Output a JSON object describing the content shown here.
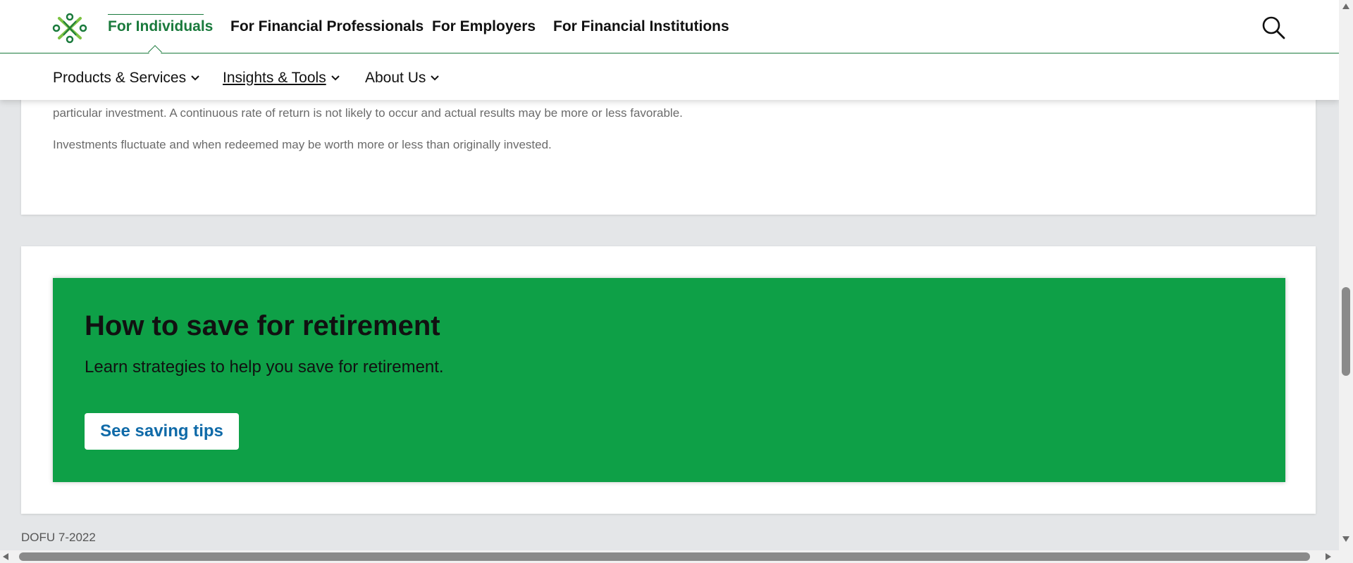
{
  "header": {
    "top_nav": [
      {
        "label": "For Individuals",
        "active": true
      },
      {
        "label": "For Financial Professionals",
        "active": false
      },
      {
        "label": "For Employers",
        "active": false
      },
      {
        "label": "For Financial Institutions",
        "active": false
      }
    ],
    "sub_nav": [
      {
        "label": "Products & Services",
        "icon": "chevron-down-icon"
      },
      {
        "label": "Insights & Tools",
        "icon": "chevron-down-icon",
        "underlined": true
      },
      {
        "label": "About Us",
        "icon": "chevron-down-icon"
      }
    ],
    "search_icon": "search-icon",
    "logo_icon": "brand-logo-icon"
  },
  "disclaimer": {
    "line1": "particular investment. A continuous rate of return is not likely to occur and actual results may be more or less favorable.",
    "line2": "Investments fluctuate and when redeemed may be worth more or less than originally invested."
  },
  "promo": {
    "title": "How to save for retirement",
    "subtitle": "Learn strategies to help you save for retirement.",
    "button_label": "See saving tips"
  },
  "footer": {
    "code": "DOFU 7-2022"
  },
  "colors": {
    "brand_green": "#1a7a3c",
    "banner_green": "#0ea047",
    "button_text_blue": "#0f6aa8",
    "page_background": "#e4e6e8"
  }
}
